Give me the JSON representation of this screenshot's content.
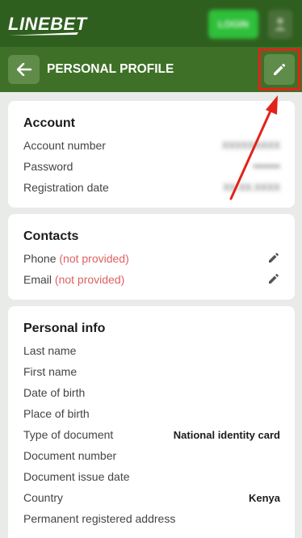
{
  "header": {
    "logo_text": "LINEBET",
    "login_label": "LOGIN"
  },
  "subheader": {
    "title": "PERSONAL PROFILE"
  },
  "account": {
    "title": "Account",
    "rows": [
      {
        "label": "Account number",
        "value": "XXXXXXXXX"
      },
      {
        "label": "Password",
        "value": "••••••••"
      },
      {
        "label": "Registration date",
        "value": "XX.XX.XXXX"
      }
    ]
  },
  "contacts": {
    "title": "Contacts",
    "rows": [
      {
        "label": "Phone",
        "status": "(not provided)"
      },
      {
        "label": "Email",
        "status": "(not provided)"
      }
    ]
  },
  "personal": {
    "title": "Personal info",
    "rows": [
      {
        "label": "Last name",
        "value": ""
      },
      {
        "label": "First name",
        "value": ""
      },
      {
        "label": "Date of birth",
        "value": ""
      },
      {
        "label": "Place of birth",
        "value": ""
      },
      {
        "label": "Type of document",
        "value": "National identity card"
      },
      {
        "label": "Document number",
        "value": ""
      },
      {
        "label": "Document issue date",
        "value": ""
      },
      {
        "label": "Country",
        "value": "Kenya"
      },
      {
        "label": "Permanent registered address",
        "value": ""
      }
    ]
  },
  "colors": {
    "topbar": "#2f5f1f",
    "subbar": "#3e7127",
    "button": "#5f8c49",
    "highlight": "#e2231a",
    "not_provided": "#e06060"
  }
}
